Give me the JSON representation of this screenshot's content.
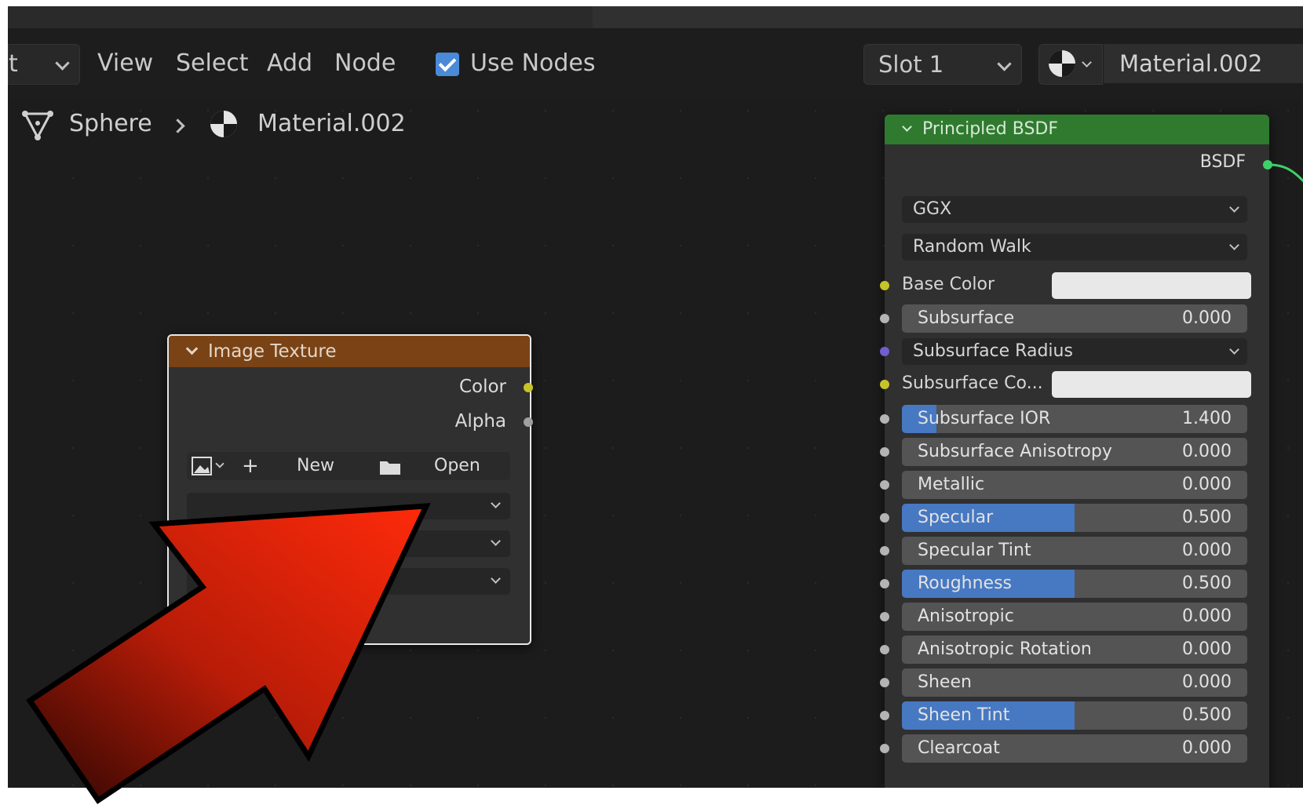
{
  "header": {
    "mode_partial": "t",
    "menus": [
      "View",
      "Select",
      "Add",
      "Node"
    ],
    "use_nodes_label": "Use Nodes",
    "use_nodes_checked": true,
    "slot_label": "Slot 1",
    "material_name": "Material.002"
  },
  "breadcrumb": {
    "object": "Sphere",
    "material": "Material.002"
  },
  "image_node": {
    "title": "Image Texture",
    "outputs": [
      "Color",
      "Alpha"
    ],
    "new_label": "New",
    "open_label": "Open",
    "colors": {
      "header": "#7a4315",
      "color_socket": "#c7c42a",
      "alpha_socket": "#a0a0a0"
    }
  },
  "bsdf_node": {
    "title": "Principled BSDF",
    "output": "BSDF",
    "distribution": "GGX",
    "subsurface_method": "Random Walk",
    "base_color_label": "Base Color",
    "subsurface_color_label": "Subsurface Co...",
    "subsurface_radius_label": "Subsurface Radius",
    "fields": [
      {
        "label": "Subsurface",
        "value": "0.000",
        "fill": 0.0
      },
      {
        "label": "Subsurface IOR",
        "value": "1.400",
        "fill": 0.1
      },
      {
        "label": "Subsurface Anisotropy",
        "value": "0.000",
        "fill": 0.0
      },
      {
        "label": "Metallic",
        "value": "0.000",
        "fill": 0.0
      },
      {
        "label": "Specular",
        "value": "0.500",
        "fill": 0.5
      },
      {
        "label": "Specular Tint",
        "value": "0.000",
        "fill": 0.0
      },
      {
        "label": "Roughness",
        "value": "0.500",
        "fill": 0.5
      },
      {
        "label": "Anisotropic",
        "value": "0.000",
        "fill": 0.0
      },
      {
        "label": "Anisotropic Rotation",
        "value": "0.000",
        "fill": 0.0
      },
      {
        "label": "Sheen",
        "value": "0.000",
        "fill": 0.0
      },
      {
        "label": "Sheen Tint",
        "value": "0.500",
        "fill": 0.5
      },
      {
        "label": "Clearcoat",
        "value": "0.000",
        "fill": 0.0
      }
    ],
    "colors": {
      "header": "#2f7a2f",
      "accent": "#4778c2",
      "bsdf_socket": "#3fcf6a",
      "yellow_socket": "#c7c42a",
      "purple_socket": "#6f5fd0"
    }
  },
  "annotation": {
    "arrow_color": "#e82a10"
  }
}
